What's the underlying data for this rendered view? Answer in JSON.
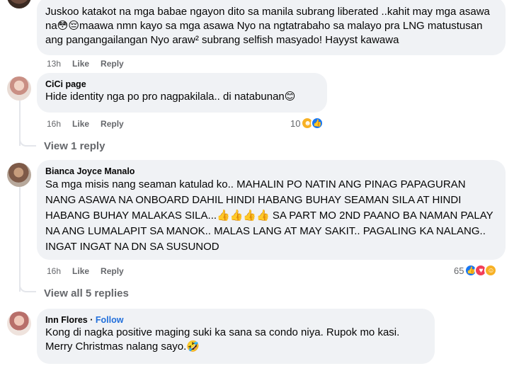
{
  "comments": [
    {
      "author": "",
      "text": "Juskoo katakot na mga babae ngayon dito sa manila subrang liberated ..kahit may mga asawa na😳😔maawa nmn kayo sa mga asawa Nyo na ngtatrabaho sa malayo pra LNG matustusan ang pangangailangan Nyo araw² subrang selfish masyado! Hayyst kawawa",
      "time": "13h",
      "like_label": "Like",
      "reply_label": "Reply"
    },
    {
      "author": "CiCi page",
      "text": "Hide identity nga po pro nagpakilala.. di natabunan😊",
      "time": "16h",
      "like_label": "Like",
      "reply_label": "Reply",
      "reaction_count": "10",
      "view_replies": "View 1 reply"
    },
    {
      "author": "Bianca Joyce Manalo",
      "text": "Sa mga misis nang seaman katulad ko.. MAHALIN PO NATIN ANG PINAG PAPAGURAN NANG ASAWA NA ONBOARD DAHIL HINDI HABANG BUHAY SEAMAN SILA AT HINDI HABANG BUHAY MALAKAS SILA...👍👍👍👍 SA PART MO 2ND PAANO BA NAMAN PALAY NA ANG LUMALAPIT SA MANOK.. MALAS LANG AT MAY SAKIT.. PAGALING KA NALANG.. INGAT INGAT NA DN SA SUSUNOD",
      "time": "16h",
      "like_label": "Like",
      "reply_label": "Reply",
      "reaction_count": "65",
      "view_replies": "View all 5 replies"
    },
    {
      "author": "Inn Flores",
      "follow_label": "Follow",
      "text": "Kong di nagka positive maging suki ka sana sa condo niya. Rupok mo kasi. Merry Christmas nalang sayo.🤣"
    }
  ],
  "colors": {
    "bubble": "#f0f2f5",
    "link": "#216fdb",
    "secondary_text": "#65676b",
    "like_blue": "#1877f2",
    "love_red": "#f33e58",
    "haha_yellow": "#f7b125"
  },
  "icons": [
    "like-reaction-icon",
    "love-reaction-icon",
    "haha-reaction-icon",
    "care-reaction-icon"
  ]
}
